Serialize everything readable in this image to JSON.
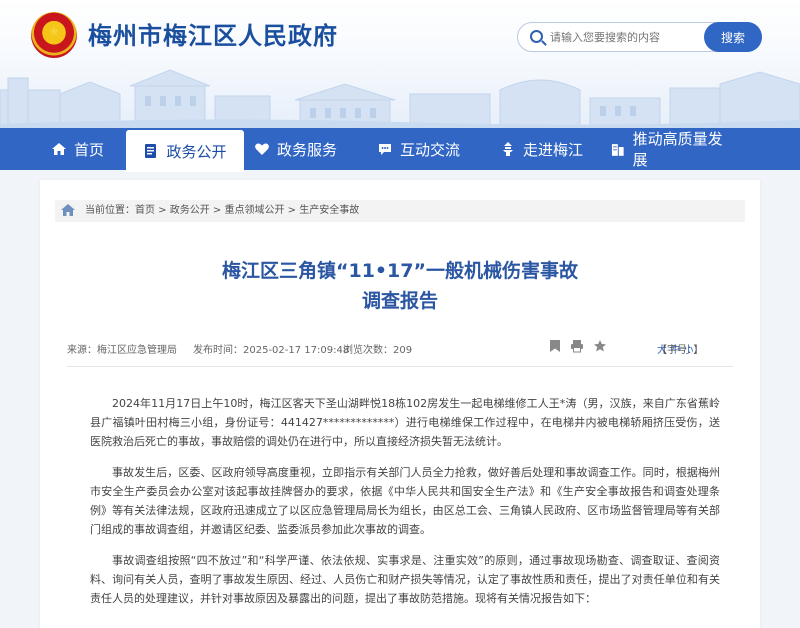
{
  "site": {
    "title": "梅州市梅江区人民政府"
  },
  "search": {
    "placeholder": "请输入您要搜索的内容",
    "button": "搜索"
  },
  "nav": {
    "items": [
      {
        "label": "首页",
        "icon": "home-icon",
        "active": false
      },
      {
        "label": "政务公开",
        "icon": "document-icon",
        "active": true
      },
      {
        "label": "政务服务",
        "icon": "heart-icon",
        "active": false
      },
      {
        "label": "互动交流",
        "icon": "chat-icon",
        "active": false
      },
      {
        "label": "走进梅江",
        "icon": "pagoda-icon",
        "active": false
      },
      {
        "label": "推动高质量发展",
        "icon": "building-icon",
        "active": false
      }
    ]
  },
  "breadcrumb": "当前位置：首页 > 政务公开 > 重点领域公开 > 生产安全事故",
  "article": {
    "title_line1": "梅江区三角镇“11•17”一般机械伤害事故",
    "title_line2": "调查报告",
    "source": "来源：梅江区应急管理局",
    "published": "发布时间：2025-02-17 17:09:48",
    "views": "浏览次数：209",
    "font_size_prefix": "【字号：",
    "font_size_options": [
      "大",
      "中",
      "小"
    ],
    "font_size_suffix": "】",
    "paragraphs": [
      "2024年11月17日上午10时，梅江区客天下圣山湖畔悦18栋102房发生一起电梯维修工人王*涛（男，汉族，来自广东省蕉岭县广福镇叶田村梅三小组，身份证号：441427*************）进行电梯维保工作过程中，在电梯井内被电梯轿厢挤压受伤，送医院救治后死亡的事故，事故赔偿的调处仍在进行中，所以直接经济损失暂无法统计。",
      "事故发生后，区委、区政府领导高度重视，立即指示有关部门人员全力抢救，做好善后处理和事故调查工作。同时，根据梅州市安全生产委员会办公室对该起事故挂牌督办的要求，依据《中华人民共和国安全生产法》和《生产安全事故报告和调查处理条例》等有关法律法规，区政府迅速成立了以区应急管理局局长为组长，由区总工会、三角镇人民政府、区市场监督管理局等有关部门组成的事故调查组，并邀请区纪委、监委派员参加此次事故的调查。",
      "事故调查组按照“四不放过”和“科学严谨、依法依规、实事求是、注重实效”的原则，通过事故现场勘查、调查取证、查阅资料、询问有关人员，查明了事故发生原因、经过、人员伤亡和财产损失等情况，认定了事故性质和责任，提出了对责任单位和有关责任人员的处理建议，并针对事故原因及暴露出的问题，提出了事故防范措施。现将有关情况报告如下："
    ]
  }
}
